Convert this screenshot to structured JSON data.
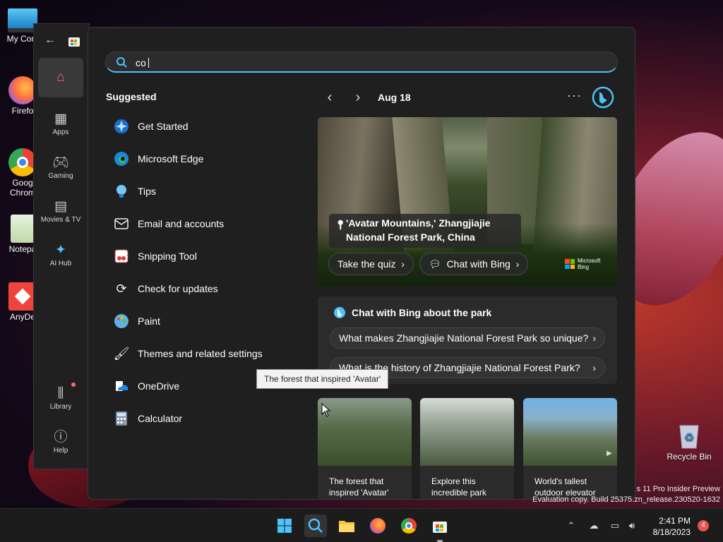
{
  "desktop": {
    "icons": [
      {
        "label": "My Com",
        "icon": "computer-icon"
      },
      {
        "label": "Firefo",
        "icon": "firefox-icon"
      },
      {
        "label": "Goog",
        "label2": "Chrom",
        "icon": "chrome-icon"
      },
      {
        "label": "Notepa",
        "icon": "notepad-icon"
      },
      {
        "label": "AnyDe",
        "icon": "anydesk-icon"
      }
    ],
    "recycle_bin": "Recycle Bin",
    "watermark_line1": "s 11 Pro Insider Preview",
    "watermark_line2": "Evaluation copy. Build 25375.zn_release.230520-1632"
  },
  "store_rail": {
    "items": [
      {
        "label": "",
        "icon": "home-icon"
      },
      {
        "label": "Apps",
        "icon": "apps-icon"
      },
      {
        "label": "Gaming",
        "icon": "gamepad-icon"
      },
      {
        "label": "Movies & TV",
        "icon": "clapperboard-icon"
      },
      {
        "label": "AI Hub",
        "icon": "sparkle-icon"
      }
    ],
    "library": "Library",
    "help": "Help"
  },
  "search": {
    "query": "co",
    "suggested_title": "Suggested",
    "suggestions": [
      {
        "label": "Get Started",
        "icon": "get-started-icon"
      },
      {
        "label": "Microsoft Edge",
        "icon": "edge-icon"
      },
      {
        "label": "Tips",
        "icon": "tips-icon"
      },
      {
        "label": "Email and accounts",
        "icon": "mail-icon"
      },
      {
        "label": "Snipping Tool",
        "icon": "snipping-tool-icon"
      },
      {
        "label": "Check for updates",
        "icon": "refresh-icon"
      },
      {
        "label": "Paint",
        "icon": "paint-icon"
      },
      {
        "label": "Themes and related settings",
        "icon": "brush-icon"
      },
      {
        "label": "OneDrive",
        "icon": "onedrive-icon"
      },
      {
        "label": "Calculator",
        "icon": "calculator-icon"
      }
    ]
  },
  "highlights": {
    "date": "Aug 18",
    "more": "···",
    "hero_caption_line1": "'Avatar Mountains,' Zhangjiajie",
    "hero_caption_line2": "National Forest Park, China",
    "quiz_label": "Take the quiz",
    "chat_label": "Chat with Bing",
    "brand_line1": "Microsoft",
    "brand_line2": "Bing",
    "chat_card_title": "Chat with Bing about the park",
    "questions": [
      "What makes Zhangjiajie National Forest Park so unique?",
      "What is the history of Zhangjiajie National Forest Park?"
    ],
    "tooltip": "The forest that inspired 'Avatar'",
    "thumbnails": [
      {
        "line1": "The forest that",
        "line2": "inspired 'Avatar'"
      },
      {
        "line1": "Explore this",
        "line2": "incredible park"
      },
      {
        "line1": "World's tallest",
        "line2": "outdoor elevator"
      }
    ]
  },
  "taskbar": {
    "apps": [
      "windows-start-icon",
      "search-icon",
      "file-explorer-icon",
      "firefox-icon",
      "chrome-icon",
      "store-icon"
    ],
    "time": "2:41 PM",
    "date": "8/18/2023",
    "notifications": "4"
  },
  "colors": {
    "accent": "#4cc2ff",
    "active_home": "#ff6b6b",
    "panel": "#1f1f1f",
    "card": "#2b2b2b"
  }
}
